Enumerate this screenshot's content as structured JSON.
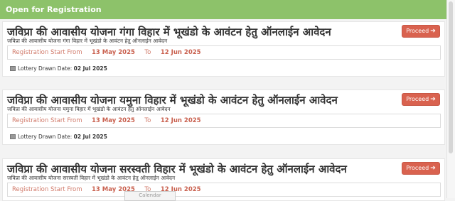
{
  "header": {
    "title": "Open for Registration"
  },
  "schemes": [
    {
      "title": "जविप्रा की आवासीय योजना गंगा विहार में भूखंडो के आवंटन हेतु ऑनलाईन आवेदन",
      "subtitle": "जविप्रा की आवासीय योजना गंगा विहार में भूखंडो के आवंटन हेतु ऑनलाईन आवेदन",
      "proceed_label": "Proceed",
      "reg_label": "Registration Start From",
      "start_date": "13 May 2025",
      "to_label": "To",
      "end_date": "12 Jun 2025",
      "lottery_label": "Lottery Drawn Date:",
      "lottery_date": "02 Jul 2025"
    },
    {
      "title": "जविप्रा की आवासीय योजना यमुना विहार में भूखंडो के आवंटन हेतु ऑनलाईन आवेदन",
      "subtitle": "जविप्रा की आवासीय योजना यमुना विहार में भूखंडो के आवंटन हेतु ऑनलाईन आवेदन",
      "proceed_label": "Proceed",
      "reg_label": "Registration Start From",
      "start_date": "13 May 2025",
      "to_label": "To",
      "end_date": "12 Jun 2025",
      "lottery_label": "Lottery Drawn Date:",
      "lottery_date": "02 Jul 2025"
    },
    {
      "title": "जविप्रा की आवासीय योजना सरस्वती विहार में भूखंडो के आवंटन हेतु ऑनलाईन आवेदन",
      "subtitle": "जविप्रा की आवासीय योजना सरस्वती विहार में भूखंडो के आवंटन हेतु ऑनलाईन आवेदन",
      "proceed_label": "Proceed",
      "reg_label": "Registration Start From",
      "start_date": "13 May 2025",
      "to_label": "To",
      "end_date": "12 Jun 2025"
    }
  ],
  "tooltip": {
    "text": "Calendar"
  },
  "colors": {
    "header_green": "#8dc26a",
    "proceed_red": "#d9624f",
    "date_red": "#c9604e"
  }
}
